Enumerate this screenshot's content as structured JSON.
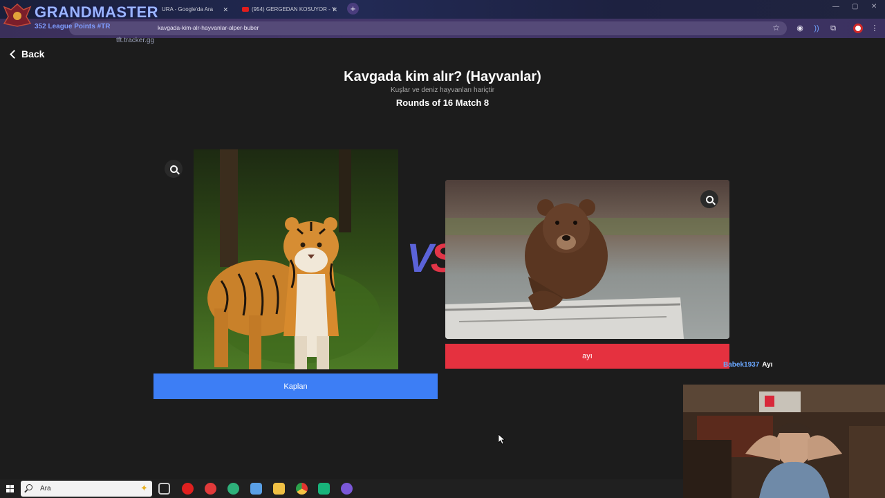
{
  "browser": {
    "tabs": [
      {
        "label": "URA - Google'da Ara"
      },
      {
        "label": "(954) GERGEDAN KOSUYOR - Y"
      }
    ],
    "new_tab_label": "+",
    "url_prefix": "~",
    "url": "kavgada-kim-alr-hayvanlar-alper-buber"
  },
  "overlay": {
    "title": "GRANDMASTER",
    "subtitle": "352 League Points #TR",
    "tracker": "tft.tracker.gg"
  },
  "page": {
    "back_label": "Back",
    "title": "Kavgada kim alır? (Hayvanlar)",
    "subtitle": "Kuşlar ve deniz hayvanları hariçtir",
    "round_label": "Rounds of 16 Match 8",
    "vs_v": "V",
    "vs_s": "S",
    "left_choice": {
      "label": "Kaplan",
      "color": "#3d7ef5"
    },
    "right_choice": {
      "label": "ayı",
      "color": "#e5313f"
    }
  },
  "chat": {
    "user": "Babek1937",
    "message": "Ayı"
  },
  "taskbar": {
    "search_placeholder": "Ara"
  }
}
